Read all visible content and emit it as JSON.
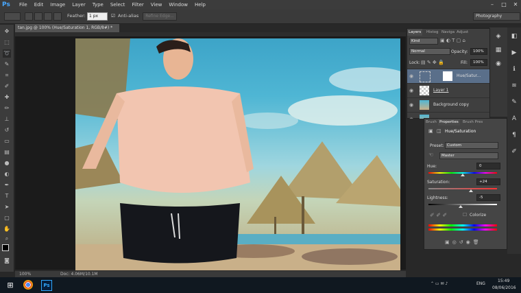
{
  "menu": {
    "logo": "Ps",
    "items": [
      "File",
      "Edit",
      "Image",
      "Layer",
      "Type",
      "Select",
      "Filter",
      "View",
      "Window",
      "Help"
    ]
  },
  "options": {
    "feather_label": "Feather:",
    "feather_value": "1 px",
    "antialias_label": "Anti-alias",
    "refine_label": "Refine Edge...",
    "workspace": "Photography"
  },
  "document": {
    "tab_title": "tan.jpg @ 100% (Hue/Saturation 1, RGB/8#) *",
    "zoom": "100%",
    "doc_size": "Doc: 4.06M/10.1M"
  },
  "layers_panel": {
    "tabs": [
      "Layers",
      "Histog",
      "Naviga",
      "Adjust"
    ],
    "kind_label": "Kind",
    "blend_mode": "Normal",
    "opacity_label": "Opacity:",
    "opacity_value": "100%",
    "lock_label": "Lock:",
    "fill_label": "Fill:",
    "fill_value": "100%",
    "layers": [
      {
        "name": "Hue/Satur...",
        "type": "adjustment",
        "selected": true
      },
      {
        "name": "Layer 1",
        "type": "empty"
      },
      {
        "name": "Background copy",
        "type": "image"
      },
      {
        "name": "",
        "type": "image"
      }
    ]
  },
  "properties_panel": {
    "tabs": [
      "Brush",
      "Properties",
      "Brush Pres"
    ],
    "title": "Hue/Saturation",
    "preset_label": "Preset:",
    "preset_value": "Custom",
    "channel_value": "Master",
    "hue_label": "Hue:",
    "hue_value": "0",
    "saturation_label": "Saturation:",
    "saturation_value": "+24",
    "lightness_label": "Lightness:",
    "lightness_value": "-5",
    "colorize_label": "Colorize"
  },
  "taskbar": {
    "lang": "ENG",
    "time": "15:49",
    "date": "08/06/2016"
  },
  "colors": {
    "ps_blue": "#49a8ff",
    "panel_bg": "#3f3f3f",
    "selected_layer": "#5a6f8a"
  }
}
